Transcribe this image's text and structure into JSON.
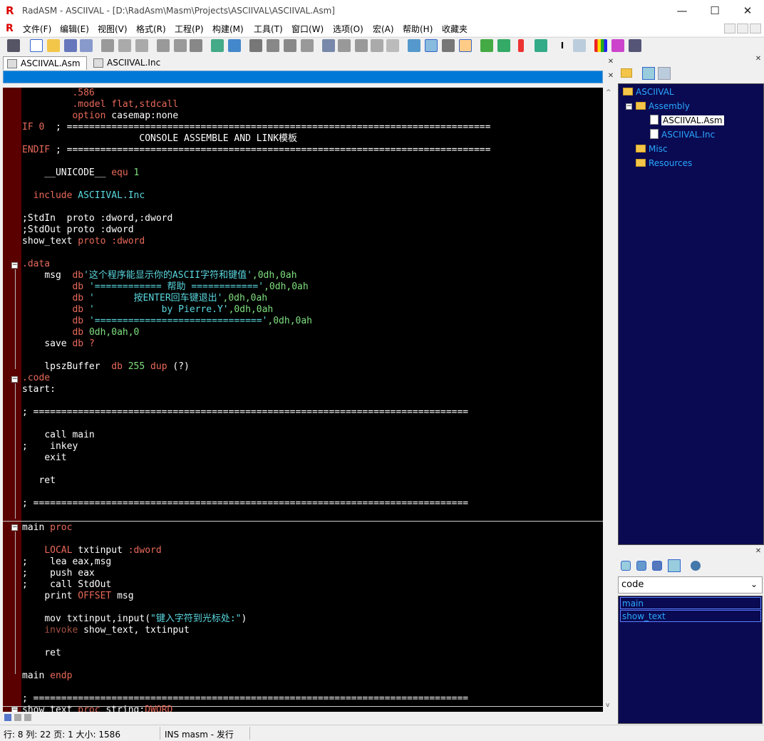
{
  "window": {
    "title": "RadASM - ASCIIVAL - [D:\\RadAsm\\Masm\\Projects\\ASCIIVAL\\ASCIIVAL.Asm]",
    "minimize": "—",
    "maximize": "☐",
    "close": "✕"
  },
  "menu": [
    "文件(F)",
    "编辑(E)",
    "视图(V)",
    "格式(R)",
    "工程(P)",
    "构建(M)",
    "工具(T)",
    "窗口(W)",
    "选项(O)",
    "宏(A)",
    "帮助(H)",
    "收藏夹"
  ],
  "tabs": [
    {
      "label": "ASCIIVAL.Asm",
      "active": true
    },
    {
      "label": "ASCIIVAL.Inc",
      "active": false
    }
  ],
  "code": {
    "l1": ".586",
    "l2a": ".model flat,",
    "l2b": "stdcall",
    "l3a": "option ",
    "l3b": "casemap:none",
    "l4a": "IF 0",
    "l4b": "; ============================================================================",
    "l5": "CONSOLE ASSEMBLE AND LINK模板",
    "l6a": "ENDIF",
    "l6b": "; ============================================================================",
    "l7a": "__UNICODE__",
    "l7b": "equ",
    "l7c": "1",
    "l8a": "include",
    "l8b": "ASCIIVAL.Inc",
    "l9": ";StdIn  proto :dword,:dword",
    "l10": ";StdOut proto :dword",
    "l11a": "show_text",
    "l11b": "proto",
    "l11c": ":dword",
    "l12": ".data",
    "l13a": "msg",
    "l13b": "db",
    "l13c": "'这个程序能显示你的ASCII字符和键值'",
    "l13d": ",0dh,0ah",
    "l14a": "db",
    "l14b": "'============ 帮助 ============'",
    "l14c": ",0dh,0ah",
    "l15a": "db",
    "l15b": "'       按ENTER回车键退出'",
    "l15c": ",0dh,0ah",
    "l16a": "db",
    "l16b": "'            by Pierre.Y'",
    "l16c": ",0dh,0ah",
    "l17a": "db",
    "l17b": "'=============================='",
    "l17c": ",0dh,0ah",
    "l18a": "db",
    "l18b": "0dh,0ah,0",
    "l19a": "save",
    "l19b": "db",
    "l19c": "?",
    "l20a": "lpszBuffer",
    "l20b": "db",
    "l20c": "255",
    "l20d": "dup",
    "l20e": "(?)",
    "l21": ".code",
    "l22": "start:",
    "l23": "; ==============================================================================",
    "l24": "call main",
    "l25": ";    inkey",
    "l26": "exit",
    "l27": "ret",
    "l28": "; ==============================================================================",
    "l29a": "main",
    "l29b": "proc",
    "l30a": "LOCAL",
    "l30b": "txtinput",
    "l30c": ":dword",
    "l31": ";    lea eax,msg",
    "l32": ";    push eax",
    "l33": ";    call StdOut",
    "l34a": "print",
    "l34b": "OFFSET",
    "l34c": "msg",
    "l35a": "mov txtinput,input(",
    "l35b": "\"键入字符到光标处:\"",
    "l35c": ")",
    "l36a": "invoke",
    "l36b": "show_text, txtinput",
    "l37": "ret",
    "l38a": "main",
    "l38b": "endp",
    "l39": "; ==============================================================================",
    "l40a": "show_text",
    "l40b": "proc",
    "l40c": "string:",
    "l40d": "DWORD"
  },
  "project_tree": {
    "root": "ASCIIVAL",
    "assembly": "Assembly",
    "file_asm": "ASCIIVAL.Asm",
    "file_inc": "ASCIIVAL.Inc",
    "misc": "Misc",
    "resources": "Resources"
  },
  "properties": {
    "selected": "code",
    "items": [
      "main",
      "show_text"
    ]
  },
  "status": {
    "position": "行: 8  列:  22 页: 1 大小: 1586",
    "mode": "INS masm - 发行"
  },
  "colors": {
    "editor_bg": "#000000",
    "keyword": "#e9695a",
    "string": "#5ad8e0",
    "number": "#7fe07f",
    "tree_bg": "#0a0a52",
    "find_bar": "#0078d7"
  }
}
